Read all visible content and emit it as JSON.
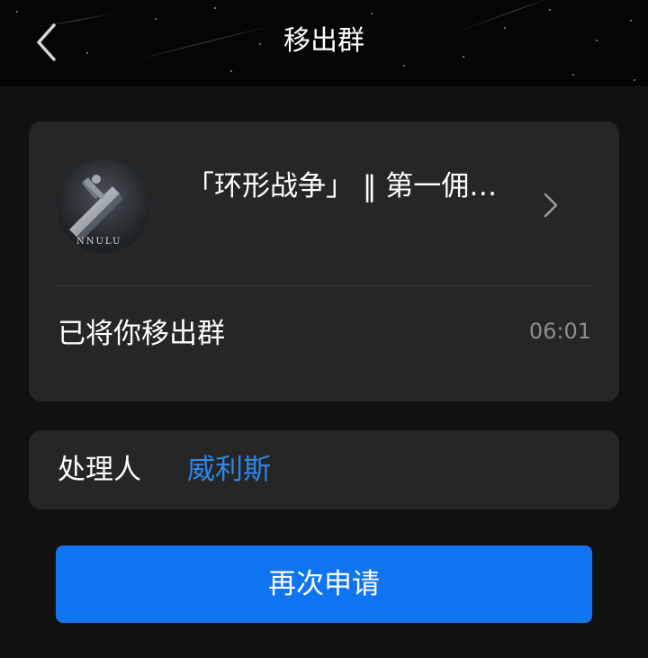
{
  "header": {
    "title": "移出群"
  },
  "group": {
    "name": "「环形战争」 ‖ 第一佣…",
    "avatar_text": "NNULU",
    "status": "已将你移出群",
    "time": "06:01"
  },
  "handler": {
    "label": "处理人",
    "name": "威利斯"
  },
  "actions": {
    "reapply_label": "再次申请"
  },
  "colors": {
    "accent": "#0f74f0",
    "link": "#2f86e6",
    "card": "#262626",
    "background": "#111111"
  },
  "icons": {
    "back": "chevron-left-icon",
    "open": "chevron-right-icon"
  }
}
